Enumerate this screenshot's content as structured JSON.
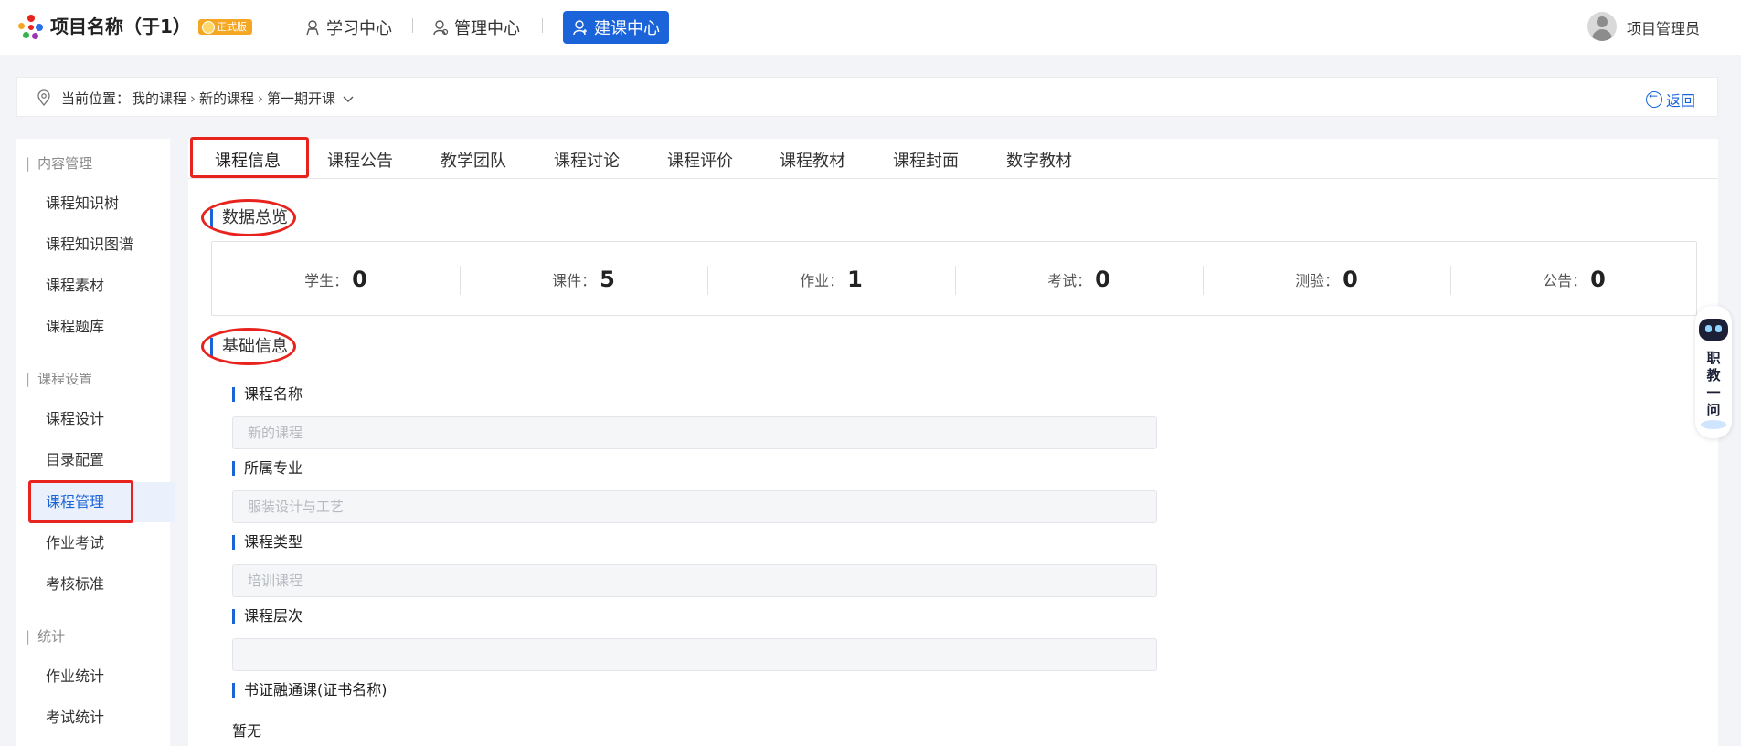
{
  "header": {
    "title": "项目名称（于1）",
    "edition_badge": "正式版",
    "nav": [
      {
        "label": "学习中心",
        "active": false
      },
      {
        "label": "管理中心",
        "active": false
      },
      {
        "label": "建课中心",
        "active": true
      }
    ],
    "user_name": "项目管理员"
  },
  "breadcrumb": {
    "prefix": "当前位置：",
    "items": [
      "我的课程",
      "新的课程",
      "第一期开课"
    ],
    "back_label": "返回"
  },
  "sidebar": {
    "groups": [
      {
        "title": "内容管理",
        "items": [
          "课程知识树",
          "课程知识图谱",
          "课程素材",
          "课程题库"
        ]
      },
      {
        "title": "课程设置",
        "items": [
          "课程设计",
          "目录配置",
          "课程管理",
          "作业考试",
          "考核标准"
        ]
      },
      {
        "title": "统计",
        "items": [
          "作业统计",
          "考试统计"
        ]
      }
    ],
    "active_item": "课程管理"
  },
  "tabs": [
    "课程信息",
    "课程公告",
    "教学团队",
    "课程讨论",
    "课程评价",
    "课程教材",
    "课程封面",
    "数字教材"
  ],
  "active_tab": "课程信息",
  "overview": {
    "title": "数据总览",
    "stats": [
      {
        "label": "学生：",
        "value": "0"
      },
      {
        "label": "课件：",
        "value": "5"
      },
      {
        "label": "作业：",
        "value": "1"
      },
      {
        "label": "考试：",
        "value": "0"
      },
      {
        "label": "测验：",
        "value": "0"
      },
      {
        "label": "公告：",
        "value": "0"
      }
    ]
  },
  "basic_info": {
    "title": "基础信息",
    "fields": [
      {
        "label": "课程名称",
        "value": "新的课程"
      },
      {
        "label": "所属专业",
        "value": "服装设计与工艺"
      },
      {
        "label": "课程类型",
        "value": "培训课程"
      },
      {
        "label": "课程层次",
        "value": ""
      },
      {
        "label": "书证融通课(证书名称)",
        "text": "暂无"
      }
    ]
  },
  "assistant": {
    "label": "职教一问"
  },
  "colors": {
    "accent": "#1a63d8",
    "annotation_red": "#e8231d",
    "badge": "#f5a623"
  },
  "icons": [
    "logo-icon",
    "study-icon",
    "manage-icon",
    "build-icon",
    "location-pin-icon",
    "chevron-right-icon",
    "chevron-down-icon",
    "back-circle-icon",
    "user-avatar-icon",
    "robot-icon"
  ]
}
